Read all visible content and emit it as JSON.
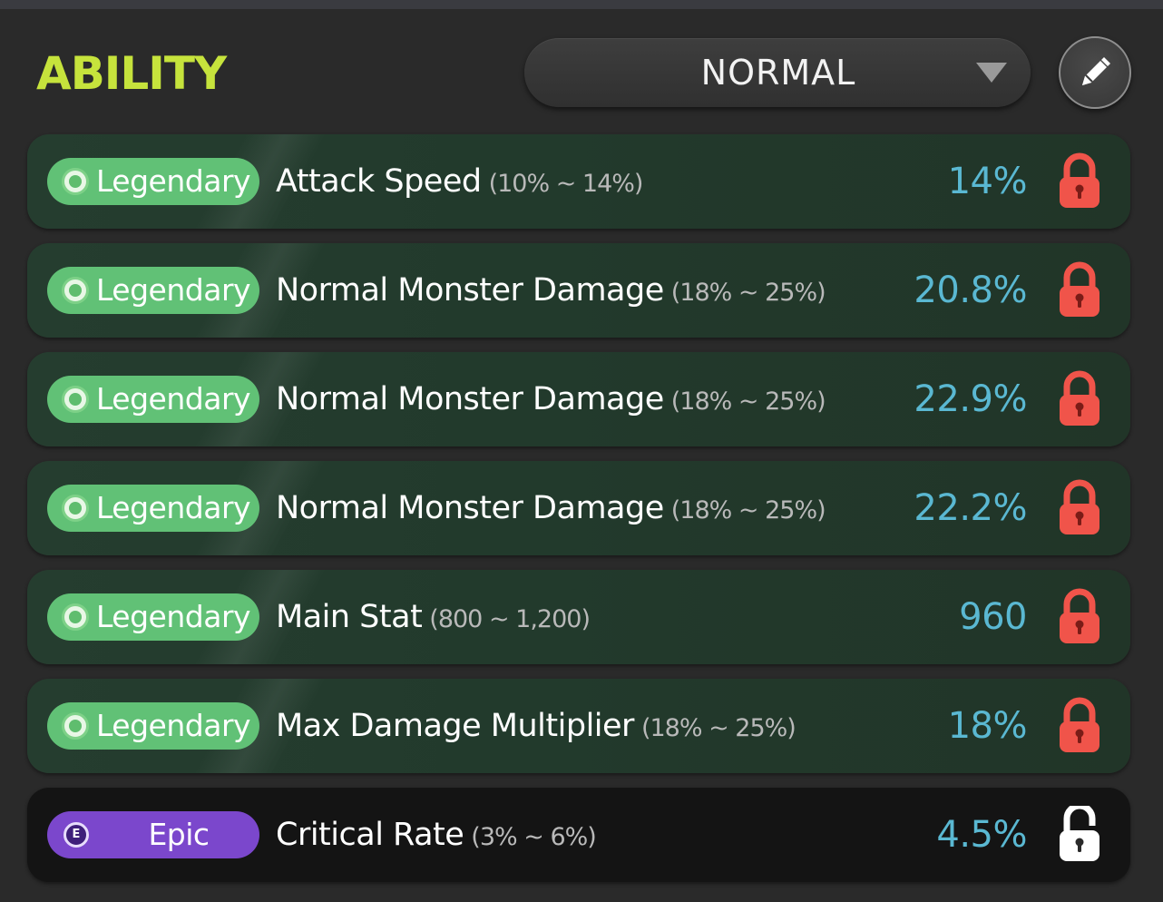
{
  "title": "ABILITY",
  "preset_dropdown": {
    "value": "NORMAL",
    "icon": "chevron-down-icon"
  },
  "edit_button": {
    "icon": "pencil-icon"
  },
  "colors": {
    "title": "#c6e33c",
    "legendary_badge": "#61c176",
    "epic_badge": "#7b47cc",
    "value_text": "#5ab8d2",
    "locked_icon": "#f0544a",
    "unlocked_icon": "#ffffff"
  },
  "abilities": [
    {
      "tier": "legendary",
      "tier_label": "Legendary",
      "name": "Attack Speed",
      "range": "(10% ~ 14%)",
      "value": "14%",
      "lock_icon": "padlock-icon",
      "lock_color": "#f0544a"
    },
    {
      "tier": "legendary",
      "tier_label": "Legendary",
      "name": "Normal Monster Damage",
      "range": "(18% ~ 25%)",
      "value": "20.8%",
      "lock_icon": "padlock-icon",
      "lock_color": "#f0544a"
    },
    {
      "tier": "legendary",
      "tier_label": "Legendary",
      "name": "Normal Monster Damage",
      "range": "(18% ~ 25%)",
      "value": "22.9%",
      "lock_icon": "padlock-icon",
      "lock_color": "#f0544a"
    },
    {
      "tier": "legendary",
      "tier_label": "Legendary",
      "name": "Normal Monster Damage",
      "range": "(18% ~ 25%)",
      "value": "22.2%",
      "lock_icon": "padlock-icon",
      "lock_color": "#f0544a"
    },
    {
      "tier": "legendary",
      "tier_label": "Legendary",
      "name": "Main Stat",
      "range": "(800 ~ 1,200)",
      "value": "960",
      "lock_icon": "padlock-icon",
      "lock_color": "#f0544a"
    },
    {
      "tier": "legendary",
      "tier_label": "Legendary",
      "name": "Max Damage Multiplier",
      "range": "(18% ~ 25%)",
      "value": "18%",
      "lock_icon": "padlock-icon",
      "lock_color": "#f0544a"
    },
    {
      "tier": "epic",
      "tier_label": "Epic",
      "name": "Critical Rate",
      "range": "(3% ~ 6%)",
      "value": "4.5%",
      "lock_icon": "padlock-icon",
      "lock_color": "#ffffff"
    }
  ]
}
